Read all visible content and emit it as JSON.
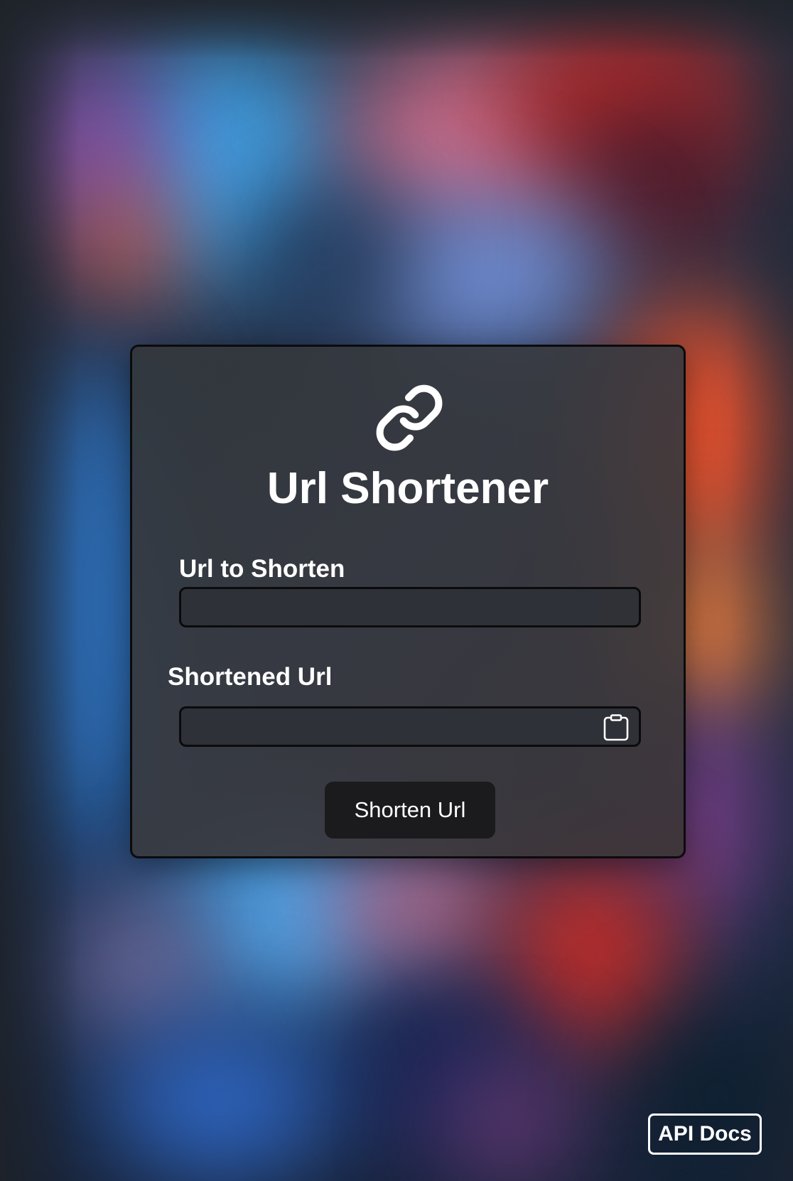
{
  "app": {
    "title": "Url Shortener",
    "icon": "link-icon"
  },
  "form": {
    "url_label": "Url to Shorten",
    "url_value": "",
    "url_placeholder": "",
    "short_label": "Shortened Url",
    "short_value": "",
    "short_placeholder": "",
    "copy_icon": "clipboard-icon",
    "submit_label": "Shorten Url"
  },
  "footer": {
    "api_docs_label": "API Docs"
  },
  "colors": {
    "card_bg": "#37393e",
    "card_border": "#0b0b0c",
    "button_bg": "#1b1b1d",
    "text": "#ffffff"
  }
}
